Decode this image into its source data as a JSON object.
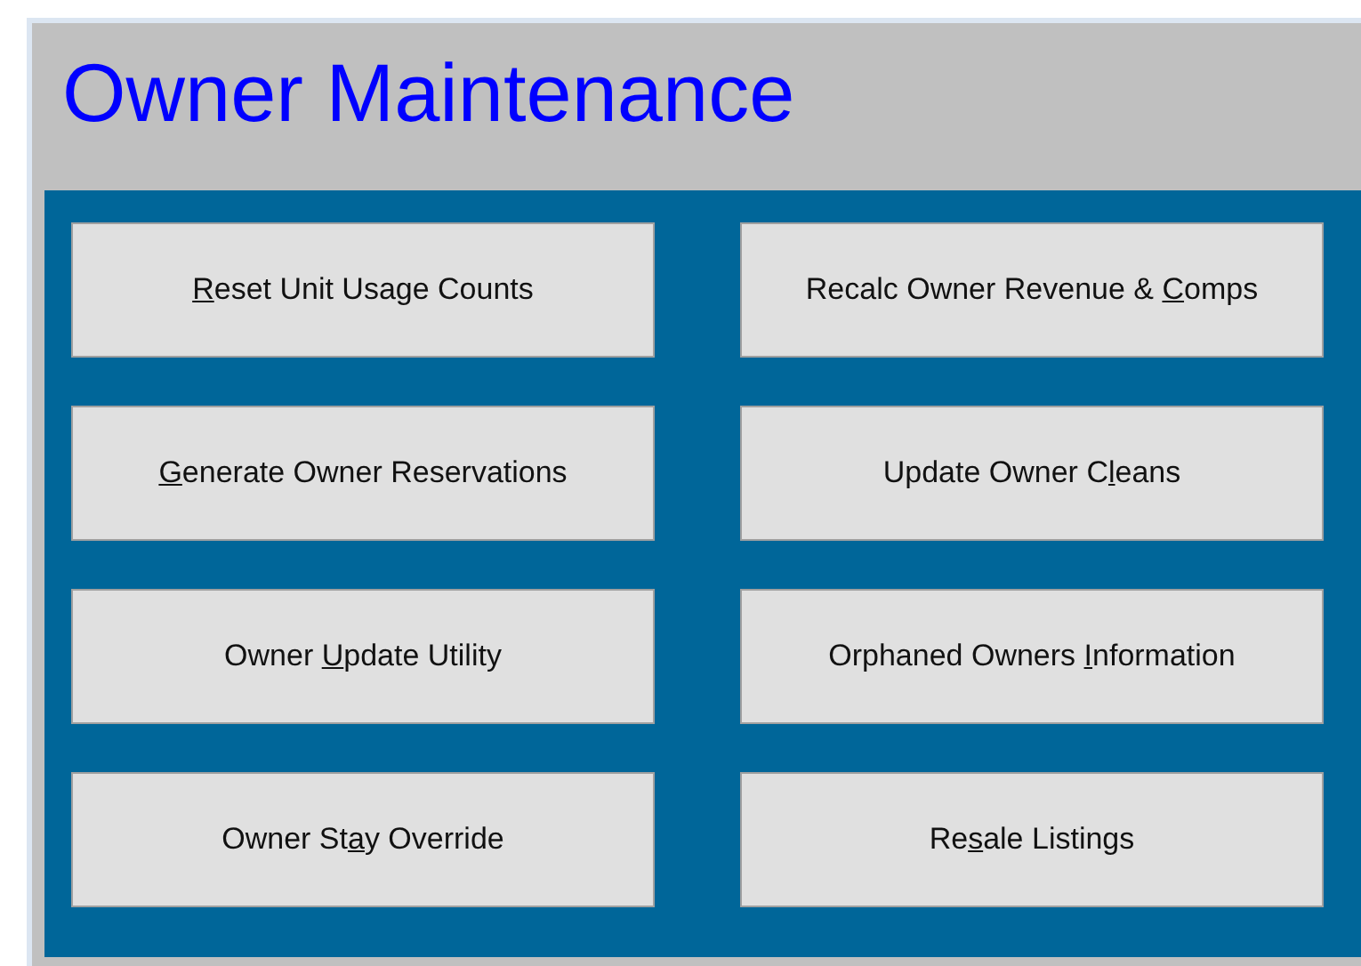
{
  "title": "Owner Maintenance",
  "buttons": [
    {
      "key": "R",
      "after": "eset Unit Usage Counts"
    },
    {
      "before": "Recalc Owner Revenue & ",
      "key": "C",
      "after": "omps"
    },
    {
      "key": "G",
      "after": "enerate Owner Reservations"
    },
    {
      "before": "Update Owner C",
      "key": "l",
      "after": "eans"
    },
    {
      "before": "Owner ",
      "key": "U",
      "after": "pdate Utility"
    },
    {
      "before": "Orphaned Owners ",
      "key": "I",
      "after": "nformation"
    },
    {
      "before": "Owner St",
      "key": "a",
      "after": "y Override"
    },
    {
      "before": "Re",
      "key": "s",
      "after": "ale Listings"
    }
  ]
}
